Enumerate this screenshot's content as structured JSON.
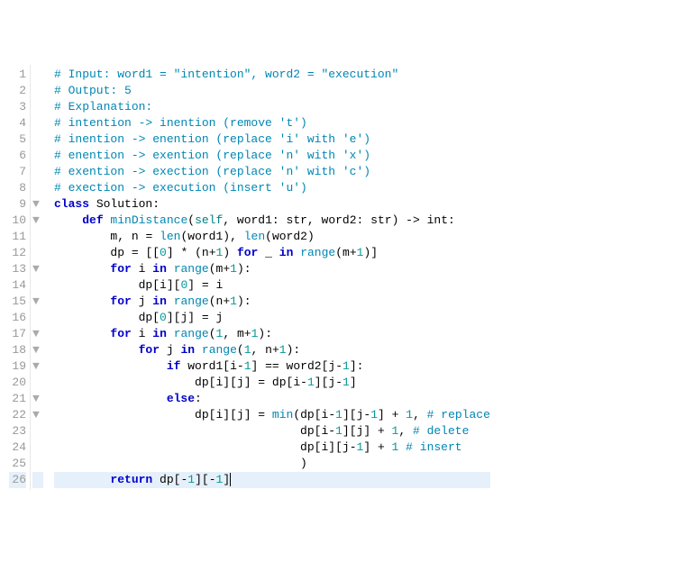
{
  "editor": {
    "cursor_line": 26,
    "lines": [
      {
        "n": 1,
        "fold": "",
        "tokens": [
          [
            "c-comment",
            "# Input: word1 = \"intention\", word2 = \"execution\""
          ]
        ]
      },
      {
        "n": 2,
        "fold": "",
        "tokens": [
          [
            "c-comment",
            "# Output: 5"
          ]
        ]
      },
      {
        "n": 3,
        "fold": "",
        "tokens": [
          [
            "c-comment",
            "# Explanation:"
          ]
        ]
      },
      {
        "n": 4,
        "fold": "",
        "tokens": [
          [
            "c-comment",
            "# intention -> inention (remove 't')"
          ]
        ]
      },
      {
        "n": 5,
        "fold": "",
        "tokens": [
          [
            "c-comment",
            "# inention -> enention (replace 'i' with 'e')"
          ]
        ]
      },
      {
        "n": 6,
        "fold": "",
        "tokens": [
          [
            "c-comment",
            "# enention -> exention (replace 'n' with 'x')"
          ]
        ]
      },
      {
        "n": 7,
        "fold": "",
        "tokens": [
          [
            "c-comment",
            "# exention -> exection (replace 'n' with 'c')"
          ]
        ]
      },
      {
        "n": 8,
        "fold": "",
        "tokens": [
          [
            "c-comment",
            "# exection -> execution (insert 'u')"
          ]
        ]
      },
      {
        "n": 9,
        "fold": "▼",
        "tokens": [
          [
            "c-kw",
            "class"
          ],
          [
            "",
            ""
          ],
          [
            "c-var",
            " Solution"
          ],
          [
            "c-op",
            ":"
          ]
        ]
      },
      {
        "n": 10,
        "fold": "▼",
        "tokens": [
          [
            "",
            "    "
          ],
          [
            "c-kw",
            "def"
          ],
          [
            "",
            ""
          ],
          [
            "c-fn",
            " minDistance"
          ],
          [
            "c-paren",
            "("
          ],
          [
            "c-self",
            "self"
          ],
          [
            "c-op",
            ", "
          ],
          [
            "c-var",
            "word1"
          ],
          [
            "c-op",
            ": "
          ],
          [
            "c-type",
            "str"
          ],
          [
            "c-op",
            ", "
          ],
          [
            "c-var",
            "word2"
          ],
          [
            "c-op",
            ": "
          ],
          [
            "c-type",
            "str"
          ],
          [
            "c-paren",
            ")"
          ],
          [
            "c-op",
            " -> "
          ],
          [
            "c-type",
            "int"
          ],
          [
            "c-op",
            ":"
          ]
        ]
      },
      {
        "n": 11,
        "fold": "",
        "tokens": [
          [
            "",
            "        "
          ],
          [
            "c-var",
            "m"
          ],
          [
            "c-op",
            ", "
          ],
          [
            "c-var",
            "n"
          ],
          [
            "c-op",
            " = "
          ],
          [
            "c-fn",
            "len"
          ],
          [
            "c-paren",
            "("
          ],
          [
            "c-var",
            "word1"
          ],
          [
            "c-paren",
            ")"
          ],
          [
            "c-op",
            ", "
          ],
          [
            "c-fn",
            "len"
          ],
          [
            "c-paren",
            "("
          ],
          [
            "c-var",
            "word2"
          ],
          [
            "c-paren",
            ")"
          ]
        ]
      },
      {
        "n": 12,
        "fold": "",
        "tokens": [
          [
            "",
            "        "
          ],
          [
            "c-var",
            "dp"
          ],
          [
            "c-op",
            " = "
          ],
          [
            "c-paren",
            "[["
          ],
          [
            "c-num",
            "0"
          ],
          [
            "c-paren",
            "]"
          ],
          [
            "c-op",
            " * "
          ],
          [
            "c-paren",
            "("
          ],
          [
            "c-var",
            "n"
          ],
          [
            "c-op",
            "+"
          ],
          [
            "c-num",
            "1"
          ],
          [
            "c-paren",
            ")"
          ],
          [
            "c-op",
            " "
          ],
          [
            "c-kw",
            "for"
          ],
          [
            "c-op",
            " _ "
          ],
          [
            "c-kw",
            "in"
          ],
          [
            "c-op",
            " "
          ],
          [
            "c-fn",
            "range"
          ],
          [
            "c-paren",
            "("
          ],
          [
            "c-var",
            "m"
          ],
          [
            "c-op",
            "+"
          ],
          [
            "c-num",
            "1"
          ],
          [
            "c-paren",
            ")]"
          ]
        ]
      },
      {
        "n": 13,
        "fold": "▼",
        "tokens": [
          [
            "",
            "        "
          ],
          [
            "c-kw",
            "for"
          ],
          [
            "c-op",
            " "
          ],
          [
            "c-var",
            "i"
          ],
          [
            "c-op",
            " "
          ],
          [
            "c-kw",
            "in"
          ],
          [
            "c-op",
            " "
          ],
          [
            "c-fn",
            "range"
          ],
          [
            "c-paren",
            "("
          ],
          [
            "c-var",
            "m"
          ],
          [
            "c-op",
            "+"
          ],
          [
            "c-num",
            "1"
          ],
          [
            "c-paren",
            ")"
          ],
          [
            "c-op",
            ":"
          ]
        ]
      },
      {
        "n": 14,
        "fold": "",
        "tokens": [
          [
            "",
            "            "
          ],
          [
            "c-var",
            "dp"
          ],
          [
            "c-paren",
            "["
          ],
          [
            "c-var",
            "i"
          ],
          [
            "c-paren",
            "]["
          ],
          [
            "c-num",
            "0"
          ],
          [
            "c-paren",
            "]"
          ],
          [
            "c-op",
            " = "
          ],
          [
            "c-var",
            "i"
          ]
        ]
      },
      {
        "n": 15,
        "fold": "▼",
        "tokens": [
          [
            "",
            "        "
          ],
          [
            "c-kw",
            "for"
          ],
          [
            "c-op",
            " "
          ],
          [
            "c-var",
            "j"
          ],
          [
            "c-op",
            " "
          ],
          [
            "c-kw",
            "in"
          ],
          [
            "c-op",
            " "
          ],
          [
            "c-fn",
            "range"
          ],
          [
            "c-paren",
            "("
          ],
          [
            "c-var",
            "n"
          ],
          [
            "c-op",
            "+"
          ],
          [
            "c-num",
            "1"
          ],
          [
            "c-paren",
            ")"
          ],
          [
            "c-op",
            ":"
          ]
        ]
      },
      {
        "n": 16,
        "fold": "",
        "tokens": [
          [
            "",
            "            "
          ],
          [
            "c-var",
            "dp"
          ],
          [
            "c-paren",
            "["
          ],
          [
            "c-num",
            "0"
          ],
          [
            "c-paren",
            "]["
          ],
          [
            "c-var",
            "j"
          ],
          [
            "c-paren",
            "]"
          ],
          [
            "c-op",
            " = "
          ],
          [
            "c-var",
            "j"
          ]
        ]
      },
      {
        "n": 17,
        "fold": "▼",
        "tokens": [
          [
            "",
            "        "
          ],
          [
            "c-kw",
            "for"
          ],
          [
            "c-op",
            " "
          ],
          [
            "c-var",
            "i"
          ],
          [
            "c-op",
            " "
          ],
          [
            "c-kw",
            "in"
          ],
          [
            "c-op",
            " "
          ],
          [
            "c-fn",
            "range"
          ],
          [
            "c-paren",
            "("
          ],
          [
            "c-num",
            "1"
          ],
          [
            "c-op",
            ", "
          ],
          [
            "c-var",
            "m"
          ],
          [
            "c-op",
            "+"
          ],
          [
            "c-num",
            "1"
          ],
          [
            "c-paren",
            ")"
          ],
          [
            "c-op",
            ":"
          ]
        ]
      },
      {
        "n": 18,
        "fold": "▼",
        "tokens": [
          [
            "",
            "            "
          ],
          [
            "c-kw",
            "for"
          ],
          [
            "c-op",
            " "
          ],
          [
            "c-var",
            "j"
          ],
          [
            "c-op",
            " "
          ],
          [
            "c-kw",
            "in"
          ],
          [
            "c-op",
            " "
          ],
          [
            "c-fn",
            "range"
          ],
          [
            "c-paren",
            "("
          ],
          [
            "c-num",
            "1"
          ],
          [
            "c-op",
            ", "
          ],
          [
            "c-var",
            "n"
          ],
          [
            "c-op",
            "+"
          ],
          [
            "c-num",
            "1"
          ],
          [
            "c-paren",
            ")"
          ],
          [
            "c-op",
            ":"
          ]
        ]
      },
      {
        "n": 19,
        "fold": "▼",
        "tokens": [
          [
            "",
            "                "
          ],
          [
            "c-kw",
            "if"
          ],
          [
            "c-op",
            " "
          ],
          [
            "c-var",
            "word1"
          ],
          [
            "c-paren",
            "["
          ],
          [
            "c-var",
            "i"
          ],
          [
            "c-op",
            "-"
          ],
          [
            "c-num",
            "1"
          ],
          [
            "c-paren",
            "]"
          ],
          [
            "c-op",
            " == "
          ],
          [
            "c-var",
            "word2"
          ],
          [
            "c-paren",
            "["
          ],
          [
            "c-var",
            "j"
          ],
          [
            "c-op",
            "-"
          ],
          [
            "c-num",
            "1"
          ],
          [
            "c-paren",
            "]"
          ],
          [
            "c-op",
            ":"
          ]
        ]
      },
      {
        "n": 20,
        "fold": "",
        "tokens": [
          [
            "",
            "                    "
          ],
          [
            "c-var",
            "dp"
          ],
          [
            "c-paren",
            "["
          ],
          [
            "c-var",
            "i"
          ],
          [
            "c-paren",
            "]["
          ],
          [
            "c-var",
            "j"
          ],
          [
            "c-paren",
            "]"
          ],
          [
            "c-op",
            " = "
          ],
          [
            "c-var",
            "dp"
          ],
          [
            "c-paren",
            "["
          ],
          [
            "c-var",
            "i"
          ],
          [
            "c-op",
            "-"
          ],
          [
            "c-num",
            "1"
          ],
          [
            "c-paren",
            "]["
          ],
          [
            "c-var",
            "j"
          ],
          [
            "c-op",
            "-"
          ],
          [
            "c-num",
            "1"
          ],
          [
            "c-paren",
            "]"
          ]
        ]
      },
      {
        "n": 21,
        "fold": "▼",
        "tokens": [
          [
            "",
            "                "
          ],
          [
            "c-kw",
            "else"
          ],
          [
            "c-op",
            ":"
          ]
        ]
      },
      {
        "n": 22,
        "fold": "▼",
        "tokens": [
          [
            "",
            "                    "
          ],
          [
            "c-var",
            "dp"
          ],
          [
            "c-paren",
            "["
          ],
          [
            "c-var",
            "i"
          ],
          [
            "c-paren",
            "]["
          ],
          [
            "c-var",
            "j"
          ],
          [
            "c-paren",
            "]"
          ],
          [
            "c-op",
            " = "
          ],
          [
            "c-fn",
            "min"
          ],
          [
            "c-paren",
            "("
          ],
          [
            "c-var",
            "dp"
          ],
          [
            "c-paren",
            "["
          ],
          [
            "c-var",
            "i"
          ],
          [
            "c-op",
            "-"
          ],
          [
            "c-num",
            "1"
          ],
          [
            "c-paren",
            "]["
          ],
          [
            "c-var",
            "j"
          ],
          [
            "c-op",
            "-"
          ],
          [
            "c-num",
            "1"
          ],
          [
            "c-paren",
            "]"
          ],
          [
            "c-op",
            " + "
          ],
          [
            "c-num",
            "1"
          ],
          [
            "c-op",
            ", "
          ],
          [
            "c-comment",
            "# replace"
          ]
        ]
      },
      {
        "n": 23,
        "fold": "",
        "tokens": [
          [
            "",
            "                                   "
          ],
          [
            "c-var",
            "dp"
          ],
          [
            "c-paren",
            "["
          ],
          [
            "c-var",
            "i"
          ],
          [
            "c-op",
            "-"
          ],
          [
            "c-num",
            "1"
          ],
          [
            "c-paren",
            "]["
          ],
          [
            "c-var",
            "j"
          ],
          [
            "c-paren",
            "]"
          ],
          [
            "c-op",
            " + "
          ],
          [
            "c-num",
            "1"
          ],
          [
            "c-op",
            ", "
          ],
          [
            "c-comment",
            "# delete"
          ]
        ]
      },
      {
        "n": 24,
        "fold": "",
        "tokens": [
          [
            "",
            "                                   "
          ],
          [
            "c-var",
            "dp"
          ],
          [
            "c-paren",
            "["
          ],
          [
            "c-var",
            "i"
          ],
          [
            "c-paren",
            "]["
          ],
          [
            "c-var",
            "j"
          ],
          [
            "c-op",
            "-"
          ],
          [
            "c-num",
            "1"
          ],
          [
            "c-paren",
            "]"
          ],
          [
            "c-op",
            " + "
          ],
          [
            "c-num",
            "1"
          ],
          [
            "c-op",
            " "
          ],
          [
            "c-comment",
            "# insert"
          ]
        ]
      },
      {
        "n": 25,
        "fold": "",
        "tokens": [
          [
            "",
            "                                   "
          ],
          [
            "c-paren",
            ")"
          ]
        ]
      },
      {
        "n": 26,
        "fold": "",
        "tokens": [
          [
            "",
            "        "
          ],
          [
            "c-kw",
            "return"
          ],
          [
            "c-op",
            " "
          ],
          [
            "c-var",
            "dp"
          ],
          [
            "c-paren",
            "["
          ],
          [
            "c-op",
            "-"
          ],
          [
            "c-num",
            "1"
          ],
          [
            "c-paren",
            "]["
          ],
          [
            "c-op",
            "-"
          ],
          [
            "c-num",
            "1"
          ],
          [
            "c-paren",
            "]"
          ]
        ]
      }
    ]
  }
}
